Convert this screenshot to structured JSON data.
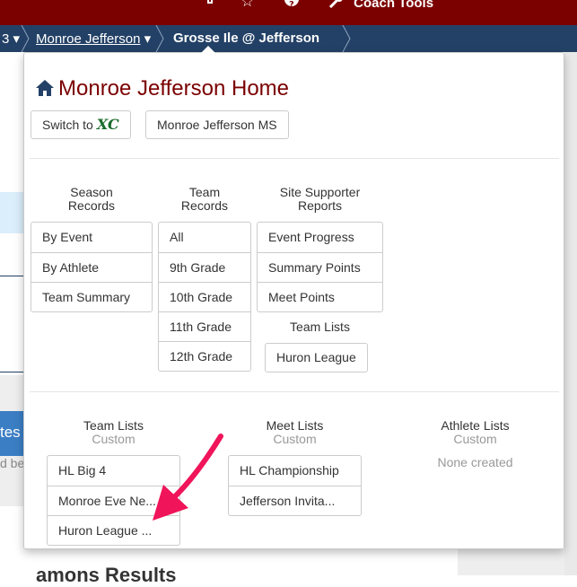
{
  "topbar": {
    "icons": [
      "lightbulb-icon",
      "star-icon",
      "help-icon",
      "wrench-icon"
    ],
    "coach_tools_label": "Coach Tools"
  },
  "breadcrumb": {
    "fragment": "3",
    "team": "Monroe Jefferson",
    "meet": "Grosse Ile @ Jefferson"
  },
  "background": {
    "button_fragment": "tes",
    "small_text": "d be",
    "bottom_text": "amons Results"
  },
  "popover": {
    "title": "Monroe Jefferson Home",
    "switch_label": "Switch to",
    "switch_logo": "XC",
    "ms_button": "Monroe Jefferson MS",
    "season_records": {
      "heading_line1": "Season",
      "heading_line2": "Records",
      "items": [
        "By Event",
        "By Athlete",
        "Team Summary"
      ]
    },
    "team_records": {
      "heading_line1": "Team",
      "heading_line2": "Records",
      "items": [
        "All",
        "9th Grade",
        "10th Grade",
        "11th Grade",
        "12th Grade"
      ]
    },
    "site_supporter": {
      "heading_line1": "Site Supporter",
      "heading_line2": "Reports",
      "items": [
        "Event Progress",
        "Summary Points",
        "Meet Points"
      ],
      "team_lists_label": "Team Lists",
      "team_lists_button": "Huron League"
    },
    "custom": {
      "team_lists": {
        "heading": "Team Lists",
        "sub": "Custom",
        "items": [
          "HL Big 4",
          "Monroe Eve Ne...",
          "Huron League ..."
        ]
      },
      "meet_lists": {
        "heading": "Meet Lists",
        "sub": "Custom",
        "items": [
          "HL Championship",
          "Jefferson Invita..."
        ]
      },
      "athlete_lists": {
        "heading": "Athlete Lists",
        "sub": "Custom",
        "empty": "None created"
      }
    }
  },
  "colors": {
    "topbar": "#7b0000",
    "breadcrumb": "#234166",
    "title": "#7b0000",
    "xc_logo": "#1b6b2b",
    "arrow": "#f0145a"
  }
}
